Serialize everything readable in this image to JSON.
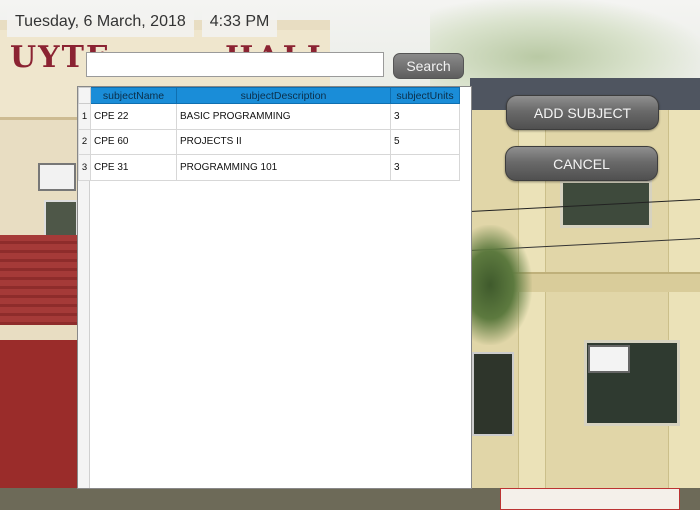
{
  "header": {
    "date": "Tuesday, 6 March, 2018",
    "time": "4:33 PM"
  },
  "background": {
    "sign_left": "UYTE",
    "sign_right": "HALL"
  },
  "search": {
    "value": "",
    "button_label": "Search"
  },
  "table": {
    "columns": [
      "subjectName",
      "subjectDescription",
      "subjectUnits"
    ],
    "rows": [
      {
        "num": "1",
        "name": "CPE 22",
        "description": "BASIC PROGRAMMING",
        "units": "3"
      },
      {
        "num": "2",
        "name": "CPE 60",
        "description": "PROJECTS II",
        "units": "5"
      },
      {
        "num": "3",
        "name": "CPE 31",
        "description": "PROGRAMMING 101",
        "units": "3"
      }
    ],
    "header_color": "#1a8dd8"
  },
  "actions": {
    "add_label": "ADD SUBJECT",
    "cancel_label": "CANCEL"
  }
}
